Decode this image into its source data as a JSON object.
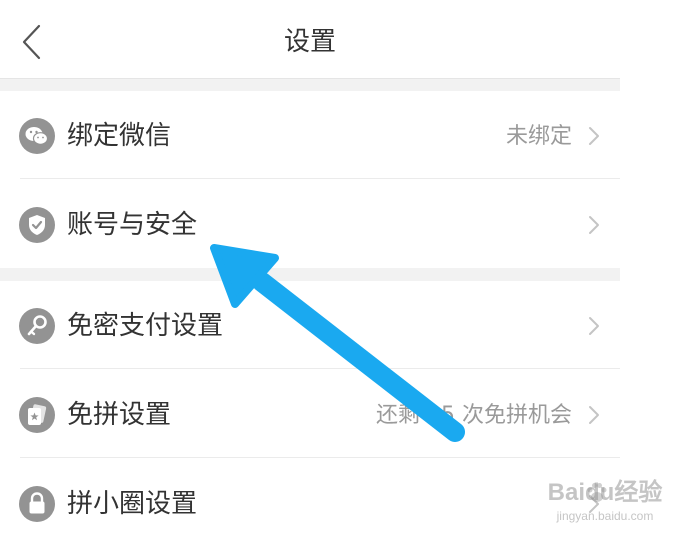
{
  "header": {
    "back_icon": "chevron-left-icon",
    "title": "设置"
  },
  "settings": {
    "items": [
      {
        "label": "绑定微信",
        "value": "未绑定",
        "icon": "wechat-icon"
      },
      {
        "label": "账号与安全",
        "value": "",
        "icon": "shield-check-icon"
      },
      {
        "label": "免密支付设置",
        "value": "",
        "icon": "key-icon"
      },
      {
        "label": "免拼设置",
        "value": "还剩 25 次免拼机会",
        "icon": "card-star-icon"
      },
      {
        "label": "拼小圈设置",
        "value": "",
        "icon": "lock-icon"
      }
    ]
  },
  "annotation": {
    "arrow_color": "#1aa9f0",
    "points_to": "账号与安全"
  },
  "watermark": {
    "main": "Baidu经验",
    "sub": "jingyan.baidu.com"
  },
  "colors": {
    "icon_gray": "#939393",
    "text_primary": "#333333",
    "text_secondary": "#9a9a9a",
    "section_gap": "#f2f2f2"
  }
}
